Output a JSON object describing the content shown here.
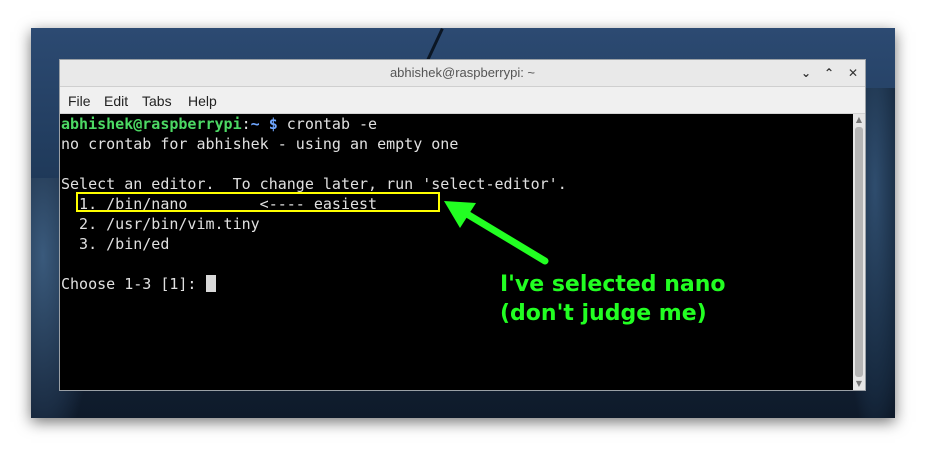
{
  "window": {
    "title": "abhishek@raspberrypi: ~",
    "controls": {
      "minimize": "⌄",
      "maximize": "⌃",
      "close": "✕"
    }
  },
  "menu": [
    "File",
    "Edit",
    "Tabs",
    "Help"
  ],
  "terminal": {
    "prompt_user": "abhishek@raspberrypi",
    "prompt_sep": ":",
    "prompt_path": "~ $",
    "command": " crontab -e",
    "lines": [
      "no crontab for abhishek - using an empty one",
      "",
      "Select an editor.  To change later, run 'select-editor'.",
      "  1. /bin/nano        <---- easiest",
      "  2. /usr/bin/vim.tiny",
      "  3. /bin/ed",
      "",
      "Choose 1-3 [1]: "
    ]
  },
  "annotation": {
    "line1": "I've selected nano",
    "line2": "(don't judge me)",
    "color": "#22ff22",
    "highlight_color": "#ffff00"
  }
}
